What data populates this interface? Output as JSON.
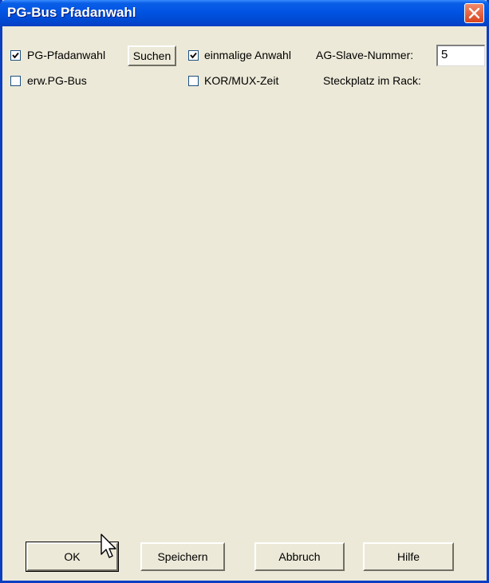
{
  "window": {
    "title": "PG-Bus Pfadanwahl"
  },
  "options": {
    "pg_pfadanwahl": {
      "label": "PG-Pfadanwahl",
      "checked": true
    },
    "suchen_label": "Suchen",
    "einmalige_anwahl": {
      "label": "einmalige Anwahl",
      "checked": true
    },
    "ag_slave_label": "AG-Slave-Nummer:",
    "ag_slave_value": "5",
    "erw_pg_bus": {
      "label": "erw.PG-Bus",
      "checked": false
    },
    "kor_mux": {
      "label": "KOR/MUX-Zeit",
      "checked": false
    },
    "steckplatz_label": "Steckplatz im Rack:"
  },
  "buttons": {
    "ok": "OK",
    "speichern": "Speichern",
    "abbruch": "Abbruch",
    "hilfe": "Hilfe"
  },
  "icons": {
    "close": "close-icon",
    "check": "checkmark-icon",
    "cursor": "mouse-pointer-icon"
  },
  "colors": {
    "titlebar": "#0054E3",
    "face": "#ECE9D8",
    "close": "#D9441E"
  }
}
